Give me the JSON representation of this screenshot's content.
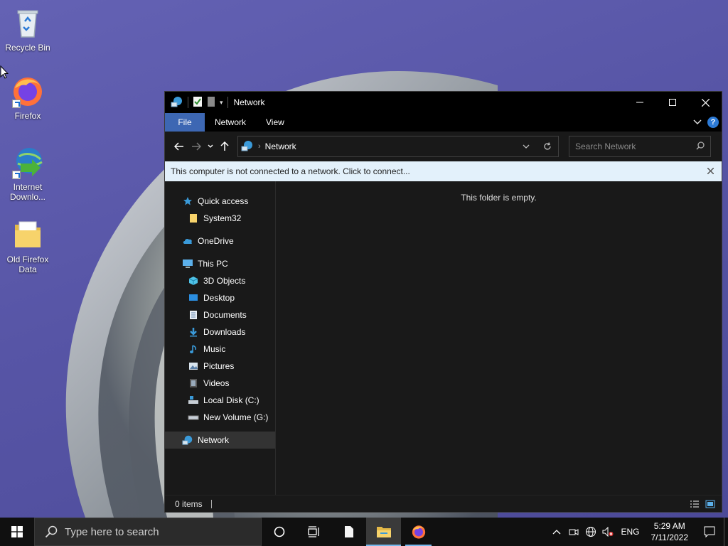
{
  "desktop": {
    "icons": [
      {
        "label": "Recycle Bin",
        "icon": "recycle-bin-icon"
      },
      {
        "label": "Firefox",
        "icon": "firefox-icon"
      },
      {
        "label": "Internet Downlo...",
        "icon": "internet-download-manager-icon"
      },
      {
        "label": "Old Firefox Data",
        "icon": "folder-icon"
      }
    ]
  },
  "window": {
    "title": "Network",
    "ribbon_tabs": [
      "File",
      "Network",
      "View"
    ],
    "address": {
      "crumb": "Network"
    },
    "search": {
      "placeholder": "Search Network"
    },
    "infobar": {
      "message": "This computer is not connected to a network. Click to connect..."
    },
    "navpane": {
      "items": [
        {
          "label": "Quick access",
          "icon": "star-icon"
        },
        {
          "label": "System32",
          "icon": "folder-icon"
        },
        {
          "label": "OneDrive",
          "icon": "cloud-icon"
        },
        {
          "label": "This PC",
          "icon": "computer-icon"
        },
        {
          "label": "3D Objects",
          "icon": "cube-icon"
        },
        {
          "label": "Desktop",
          "icon": "desktop-icon"
        },
        {
          "label": "Documents",
          "icon": "document-icon"
        },
        {
          "label": "Downloads",
          "icon": "download-icon"
        },
        {
          "label": "Music",
          "icon": "music-icon"
        },
        {
          "label": "Pictures",
          "icon": "picture-icon"
        },
        {
          "label": "Videos",
          "icon": "video-icon"
        },
        {
          "label": "Local Disk (C:)",
          "icon": "disk-icon"
        },
        {
          "label": "New Volume (G:)",
          "icon": "drive-icon"
        },
        {
          "label": "Network",
          "icon": "network-icon"
        }
      ],
      "selected": "Network"
    },
    "empty_message": "This folder is empty.",
    "status": {
      "items_count": "0 items"
    }
  },
  "taskbar": {
    "search_placeholder": "Type here to search",
    "tray": {
      "language": "ENG",
      "time": "5:29 AM",
      "date": "7/11/2022"
    }
  },
  "colors": {
    "accent": "#3d67b3",
    "infobar_bg": "#e3f1fb",
    "window_bg": "#191919",
    "titlebar_bg": "#000000",
    "desktop_bg": "#5a58a8"
  }
}
